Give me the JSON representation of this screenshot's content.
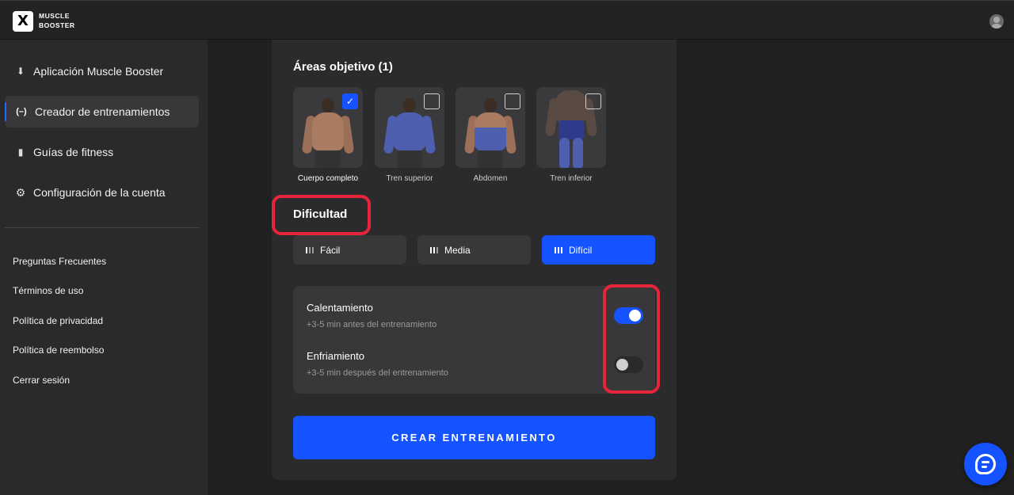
{
  "header": {
    "brand_line1": "MUSCLE",
    "brand_line2": "BOOSTER",
    "logo_mark": "X"
  },
  "sidebar": {
    "items": [
      {
        "label": "Aplicación Muscle Booster",
        "icon": "download-app-icon",
        "glyph": "⬇"
      },
      {
        "label": "Creador de entrenamientos",
        "icon": "dumbbell-icon",
        "glyph": "(–)",
        "active": true
      },
      {
        "label": "Guías de fitness",
        "icon": "book-icon",
        "glyph": "▮"
      },
      {
        "label": "Configuración de la cuenta",
        "icon": "gear-icon",
        "glyph": "⚙"
      }
    ],
    "footer_links": [
      "Preguntas Frecuentes",
      "Términos de uso",
      "Política de privacidad",
      "Política de reembolso",
      "Cerrar sesión"
    ]
  },
  "main": {
    "areas_title": "Áreas objetivo (1)",
    "areas": [
      {
        "label": "Cuerpo completo",
        "checked": true,
        "check_glyph": "✓"
      },
      {
        "label": "Tren superior",
        "checked": false
      },
      {
        "label": "Abdomen",
        "checked": false
      },
      {
        "label": "Tren inferior",
        "checked": false
      }
    ],
    "difficulty_title": "Dificultad",
    "difficulty": [
      {
        "label": "Fácil",
        "active": false
      },
      {
        "label": "Media",
        "active": false
      },
      {
        "label": "Difícil",
        "active": true
      }
    ],
    "options": [
      {
        "title": "Calentamiento",
        "subtitle": "+3-5 min antes del entrenamiento",
        "enabled": true
      },
      {
        "title": "Enfriamiento",
        "subtitle": "+3-5 min después del entrenamiento",
        "enabled": false
      }
    ],
    "cta_label": "CREAR ENTRENAMIENTO"
  },
  "colors": {
    "accent": "#1453ff",
    "highlight": "#e8243a",
    "background": "#202020",
    "sidebar": "#2a2a2c",
    "card": "#2b2b2d"
  }
}
